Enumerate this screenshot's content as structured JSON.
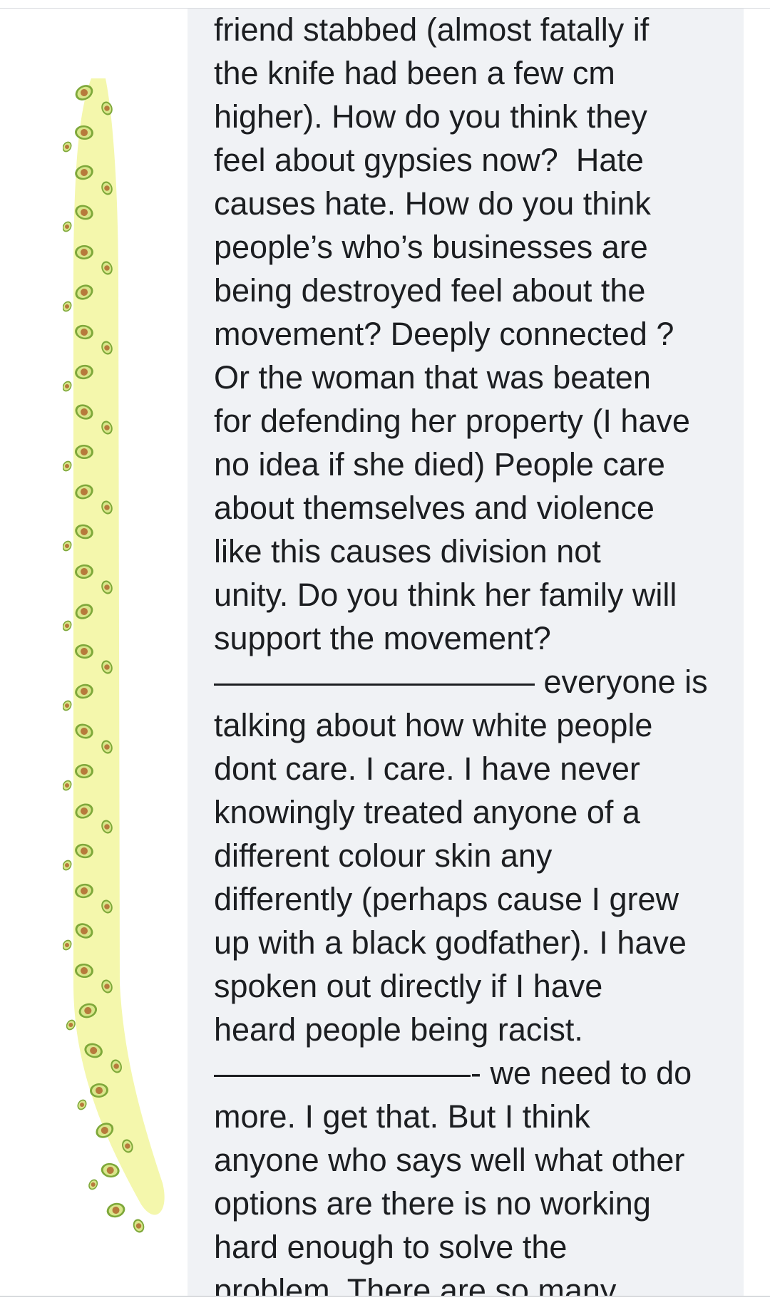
{
  "comment": {
    "lines": [
      "friend stabbed (almost fatally if",
      "the knife had been a few cm",
      "higher). How do you think they",
      "feel about gypsies now?  Hate",
      "causes hate. How do you think",
      "people’s who’s businesses are",
      "being destroyed feel about the",
      "movement? Deeply connected ?",
      "Or the woman that was beaten",
      "for defending her property (I have",
      "no idea if she died) People care",
      "about themselves and violence",
      "like this causes division not",
      "unity. Do you think her family will",
      "support the movement?",
      "—————————— everyone is",
      "talking about how white people",
      "dont care. I care. I have never",
      "knowingly treated anyone of a",
      "different colour skin any",
      "differently (perhaps cause I grew",
      "up with a black godfather). I have",
      "spoken out directly if I have",
      "heard people being racist.",
      "————————- we need to do",
      "more. I get that. But I think",
      "anyone who says well what other",
      "options are there is no working",
      "hard enough to solve the",
      "problem. There are so many"
    ]
  },
  "decoration": {
    "icon": "avocado-emoji-strip",
    "highlight_color": "#f3f7a8",
    "avocado_skin_color": "#7ea83a",
    "avocado_pit_color": "#b77a3c"
  }
}
